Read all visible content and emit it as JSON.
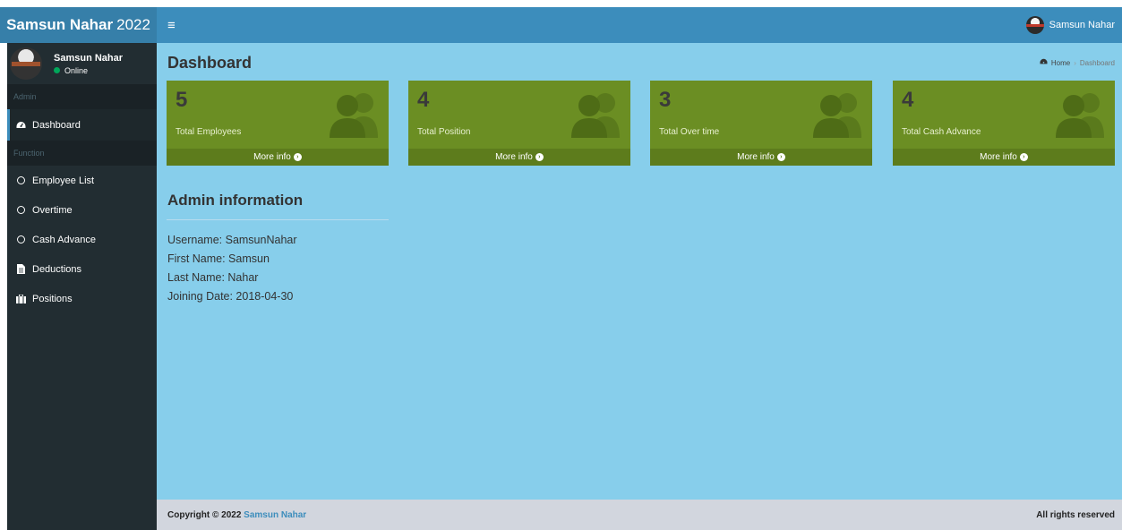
{
  "brand": {
    "bold": "Samsun Nahar",
    "rest": "2022"
  },
  "navbar": {
    "menu_icon": "≡",
    "user_name": "Samsun Nahar"
  },
  "sidebar": {
    "user_name": "Samsun Nahar",
    "user_status": "Online",
    "section_admin": "Admin",
    "section_function": "Function",
    "items": [
      {
        "label": "Dashboard",
        "icon": "dashboard-icon"
      },
      {
        "label": "Employee List",
        "icon": "circle-icon"
      },
      {
        "label": "Overtime",
        "icon": "circle-icon"
      },
      {
        "label": "Cash Advance",
        "icon": "circle-icon"
      },
      {
        "label": "Deductions",
        "icon": "file-icon"
      },
      {
        "label": "Positions",
        "icon": "briefcase-icon"
      }
    ]
  },
  "page": {
    "title": "Dashboard",
    "breadcrumb_home": "Home",
    "breadcrumb_current": "Dashboard"
  },
  "boxes": [
    {
      "number": "5",
      "label": "Total Employees",
      "footer": "More info"
    },
    {
      "number": "4",
      "label": "Total Position",
      "footer": "More info"
    },
    {
      "number": "3",
      "label": "Total Over time",
      "footer": "More info"
    },
    {
      "number": "4",
      "label": "Total Cash Advance",
      "footer": "More info"
    }
  ],
  "admin": {
    "title": "Admin information",
    "username": "Username: SamsunNahar",
    "first_name": "First Name: Samsun",
    "last_name": "Last Name: Nahar",
    "joining_date": "Joining Date: 2018-04-30"
  },
  "footer": {
    "copyright": "Copyright © 2022",
    "owner": "Samsun Nahar",
    "rights": "All rights reserved"
  },
  "colors": {
    "content_bg": "#87ceeb",
    "box_bg": "#6b8e23",
    "navbar": "#3c8dbc",
    "sidebar": "#222d32"
  }
}
